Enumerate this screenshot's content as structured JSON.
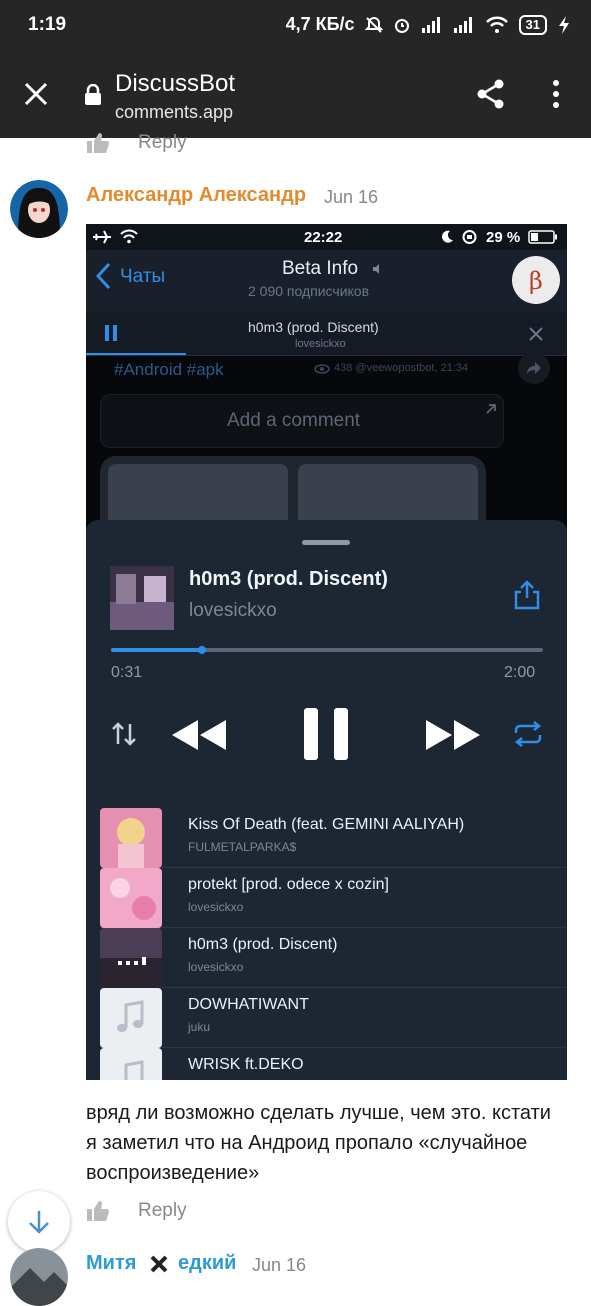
{
  "status_bar": {
    "time": "1:19",
    "net_speed": "4,7 КБ/с",
    "battery": "31"
  },
  "toolbar": {
    "title": "DiscussBot",
    "subtitle": "comments.app"
  },
  "top_reply": {
    "label": "Reply"
  },
  "comment1": {
    "author": "Александр Александр",
    "date": "Jun 16",
    "text": "вряд ли возможно сделать лучше, чем это. кстати я заметил что на Андроид пропало «случайное воспроизведение»",
    "reply_label": "Reply"
  },
  "embedded": {
    "ios_time": "22:22",
    "ios_battery": "29 %",
    "back_label": "Чаты",
    "channel_name": "Beta Info",
    "subscribers": "2 090 подписчиков",
    "avatar_letter": "β",
    "bar_title": "h0m3 (prod. Discent)",
    "bar_artist": "lovesickxo",
    "hashtags": "#Android #apk",
    "views": "438 @veewopostbot, 21:34",
    "add_comment": "Add a comment",
    "player": {
      "title": "h0m3 (prod. Discent)",
      "artist": "lovesickxo",
      "elapsed": "0:31",
      "duration": "2:00",
      "progress": 0.21
    },
    "playlist": [
      {
        "title": "Kiss Of Death (feat. GEMINI AALIYAH)",
        "artist": "FULMETALPARKA$"
      },
      {
        "title": "protekt [prod. odece x cozin]",
        "artist": "lovesickxo"
      },
      {
        "title": "h0m3 (prod. Discent)",
        "artist": "lovesickxo"
      },
      {
        "title": "DOWHATIWANT",
        "artist": "juku"
      },
      {
        "title": "WRISK ft.DEKO",
        "artist": ""
      }
    ]
  },
  "comment2": {
    "author_part1": "Митя",
    "author_part2": "едкий",
    "date": "Jun 16"
  },
  "colors": {
    "author": "#e38a2e",
    "author2": "#2e9bd6",
    "accent_blue": "#2f8fe8",
    "chrome": "#262626"
  }
}
